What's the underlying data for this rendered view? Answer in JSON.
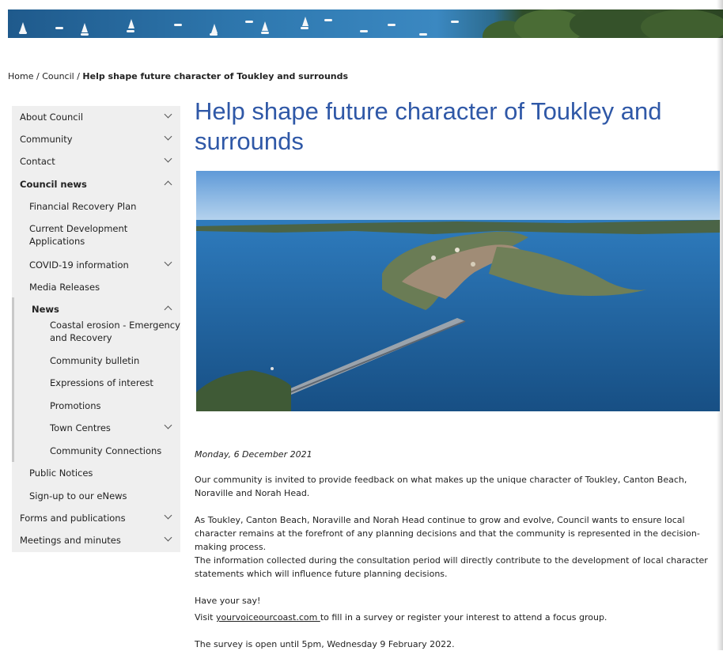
{
  "breadcrumb": {
    "home": "Home",
    "sep": " / ",
    "council": "Council",
    "current": "Help shape future character of Toukley and surrounds"
  },
  "sidebar": {
    "items": [
      {
        "label": "About Council",
        "chevron": "chevron-down-icon"
      },
      {
        "label": "Community",
        "chevron": "chevron-down-icon"
      },
      {
        "label": "Contact",
        "chevron": "chevron-down-icon"
      },
      {
        "label": "Council news",
        "chevron": "chevron-up-icon"
      },
      {
        "label": "Financial Recovery Plan"
      },
      {
        "label": "Current Development Applications"
      },
      {
        "label": "COVID-19 information",
        "chevron": "chevron-down-icon"
      },
      {
        "label": "Media Releases"
      },
      {
        "label": "News",
        "chevron": "chevron-up-icon"
      },
      {
        "label": "Coastal erosion - Emergency and Recovery"
      },
      {
        "label": "Community bulletin"
      },
      {
        "label": "Expressions of interest"
      },
      {
        "label": "Promotions"
      },
      {
        "label": "Town Centres",
        "chevron": "chevron-down-icon"
      },
      {
        "label": "Community Connections"
      },
      {
        "label": "Public Notices"
      },
      {
        "label": "Sign-up to our eNews"
      },
      {
        "label": "Forms and publications",
        "chevron": "chevron-down-icon"
      },
      {
        "label": "Meetings and minutes",
        "chevron": "chevron-down-icon"
      }
    ]
  },
  "article": {
    "title": "Help shape future character of Toukley and surrounds",
    "date": "Monday, 6 December 2021",
    "p1": "Our community is invited to provide feedback on what makes up the unique character of Toukley, Canton Beach, Noraville and Norah Head.",
    "p2": "As Toukley, Canton Beach, Noraville and Norah Head continue to grow and evolve, Council wants to ensure local character remains at the forefront of any planning decisions and that the community is represented in the decision-making process.",
    "p3": "The information collected during the consultation period will directly contribute to the development of local character statements which will influence future planning decisions.",
    "have_your_say": "Have your say!",
    "visit_prefix": "Visit ",
    "visit_link": "yourvoiceourcoast.com ",
    "visit_suffix": "to fill in a survey or register your interest to attend a focus group.",
    "survey_open": "The survey is open until 5pm, Wednesday 9 February 2022."
  },
  "colors": {
    "title": "#2f58a7",
    "sidebar_bg": "#efefef"
  }
}
